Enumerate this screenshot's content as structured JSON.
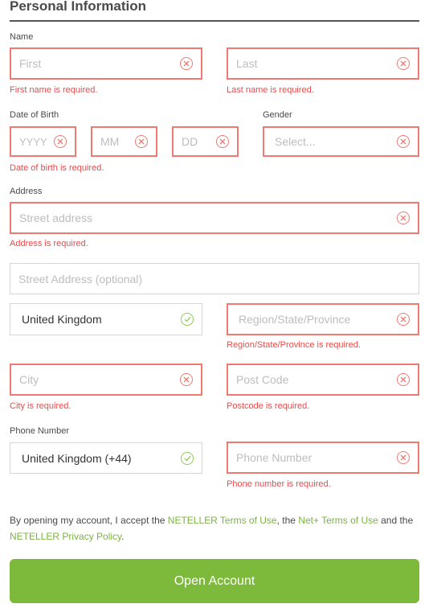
{
  "section_title": "Personal Information",
  "name": {
    "label": "Name",
    "first_placeholder": "First",
    "last_placeholder": "Last",
    "first_error": "First name is required.",
    "last_error": "Last name is required."
  },
  "dob": {
    "label": "Date of Birth",
    "year_placeholder": "YYYY",
    "month_placeholder": "MM",
    "day_placeholder": "DD",
    "error": "Date of birth is required."
  },
  "gender": {
    "label": "Gender",
    "placeholder": "Select..."
  },
  "address": {
    "label": "Address",
    "street_placeholder": "Street address",
    "street_error": "Address is required.",
    "street2_placeholder": "Street Address (optional)",
    "country_value": "United Kingdom",
    "region_placeholder": "Region/State/Province",
    "region_error": "Region/State/Province is required.",
    "city_placeholder": "City",
    "city_error": "City is required.",
    "postcode_placeholder": "Post Code",
    "postcode_error": "Postcode is required."
  },
  "phone": {
    "label": "Phone Number",
    "country_code_value": "United Kingdom (+44)",
    "number_placeholder": "Phone Number",
    "error": "Phone number is required."
  },
  "terms": {
    "prefix": "By opening my account, I accept the ",
    "link1": "NETELLER Terms of Use",
    "mid1": ", the ",
    "link2": "Net+ Terms of Use",
    "mid2": " and the ",
    "link3": "NETELLER Privacy Policy",
    "suffix": "."
  },
  "submit_label": "Open Account",
  "colors": {
    "error": "#e84c4c",
    "error_border": "#ee7a72",
    "valid": "#8fc95a",
    "accent": "#7db93a",
    "link": "#7cb342"
  },
  "icons": {
    "invalid": "x-circle-icon",
    "valid": "check-circle-icon"
  }
}
